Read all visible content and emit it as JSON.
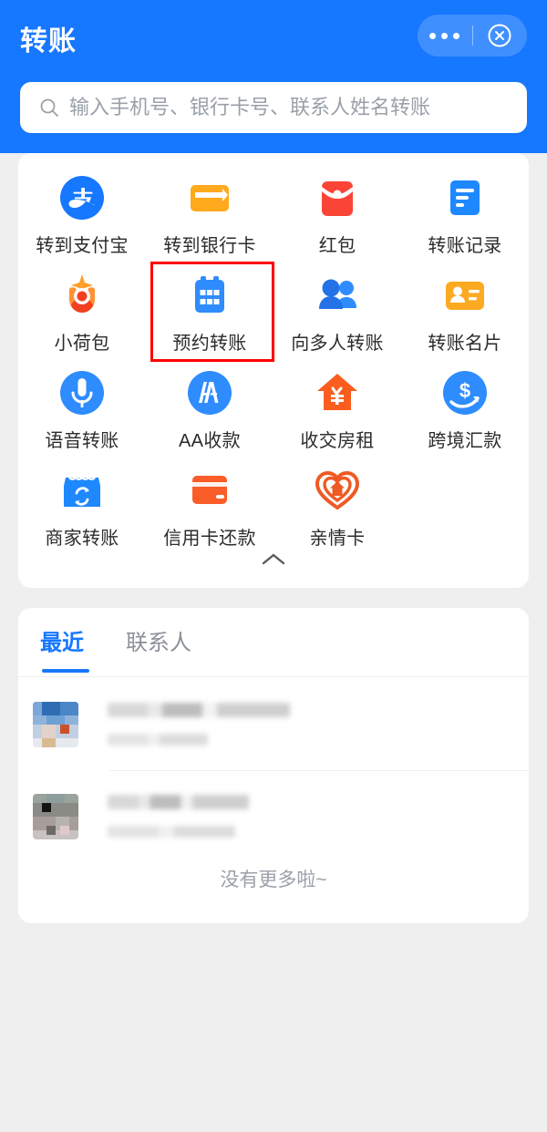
{
  "header": {
    "title": "转账",
    "bg_color": "#1677FF",
    "capsule": {
      "more_icon": "more-dots-icon",
      "close_icon": "close-circle-icon"
    }
  },
  "search": {
    "icon": "search-icon",
    "placeholder": "输入手机号、银行卡号、联系人姓名转账",
    "value": ""
  },
  "grid": {
    "highlight_color": "#FF0000",
    "collapse_icon": "chevron-up-icon",
    "items": [
      {
        "label": "转到支付宝",
        "icon": "alipay-icon",
        "color": "#1677FF"
      },
      {
        "label": "转到银行卡",
        "icon": "bank-card-icon",
        "color": "#FFAA1D"
      },
      {
        "label": "红包",
        "icon": "red-packet-icon",
        "color": "#FA4436"
      },
      {
        "label": "转账记录",
        "icon": "transfer-record-icon",
        "color": "#1E88FF"
      },
      {
        "label": "小荷包",
        "icon": "pocket-icon",
        "color": "#FF8A3D",
        "highlighted": false
      },
      {
        "label": "预约转账",
        "icon": "calendar-icon",
        "color": "#2E8CFF",
        "highlighted": true
      },
      {
        "label": "向多人转账",
        "icon": "multi-people-icon",
        "color": "#2E8CFF"
      },
      {
        "label": "转账名片",
        "icon": "name-card-icon",
        "color": "#FBAA22"
      },
      {
        "label": "语音转账",
        "icon": "microphone-icon",
        "color": "#2E8CFF"
      },
      {
        "label": "AA收款",
        "icon": "aa-split-icon",
        "color": "#2E8CFF"
      },
      {
        "label": "收交房租",
        "icon": "house-rent-icon",
        "color": "#FA5D1E"
      },
      {
        "label": "跨境汇款",
        "icon": "cross-border-icon",
        "color": "#2E8CFF"
      },
      {
        "label": "商家转账",
        "icon": "merchant-shop-icon",
        "color": "#1E88FF"
      },
      {
        "label": "信用卡还款",
        "icon": "credit-card-icon",
        "color": "#FA5D28"
      },
      {
        "label": "亲情卡",
        "icon": "family-heart-icon",
        "color": "#EE5A24"
      }
    ]
  },
  "list": {
    "tabs": [
      {
        "label": "最近",
        "active": true
      },
      {
        "label": "联系人",
        "active": false
      }
    ],
    "rows": [
      {
        "name": "",
        "subtitle": "",
        "avatar": "masked-avatar-1"
      },
      {
        "name": "",
        "subtitle": "",
        "avatar": "masked-avatar-2"
      }
    ],
    "footer_text": "没有更多啦~"
  }
}
